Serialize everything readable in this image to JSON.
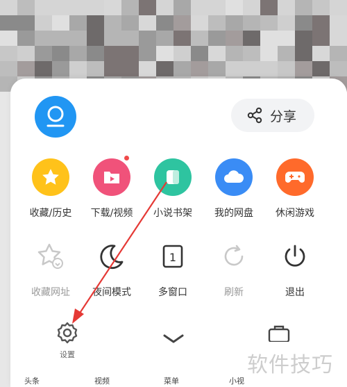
{
  "menu": {
    "share_label": "分享",
    "row1": [
      {
        "label": "收藏/历史",
        "color": "#ffc21a",
        "icon": "star-icon"
      },
      {
        "label": "下载/视频",
        "color": "#f0527a",
        "icon": "download-folder-icon",
        "badge": true
      },
      {
        "label": "小说书架",
        "color": "#2ec4a0",
        "icon": "book-icon"
      },
      {
        "label": "我的网盘",
        "color": "#3a8cf5",
        "icon": "cloud-icon"
      },
      {
        "label": "休闲游戏",
        "color": "#ff6a2b",
        "icon": "gamepad-icon"
      }
    ],
    "row2": [
      {
        "label": "收藏网址",
        "icon": "bookmark-add-icon",
        "disabled": true
      },
      {
        "label": "夜间模式",
        "icon": "moon-icon",
        "disabled": false
      },
      {
        "label": "多窗口",
        "icon": "windows-icon",
        "window_count": "1",
        "disabled": false
      },
      {
        "label": "刷新",
        "icon": "refresh-icon",
        "disabled": true
      },
      {
        "label": "退出",
        "icon": "power-icon",
        "disabled": false
      }
    ],
    "settings_label": "设置"
  },
  "tabbar": {
    "items": [
      "头条",
      "视频",
      "菜单",
      "小视"
    ]
  },
  "watermark": "软件技巧"
}
